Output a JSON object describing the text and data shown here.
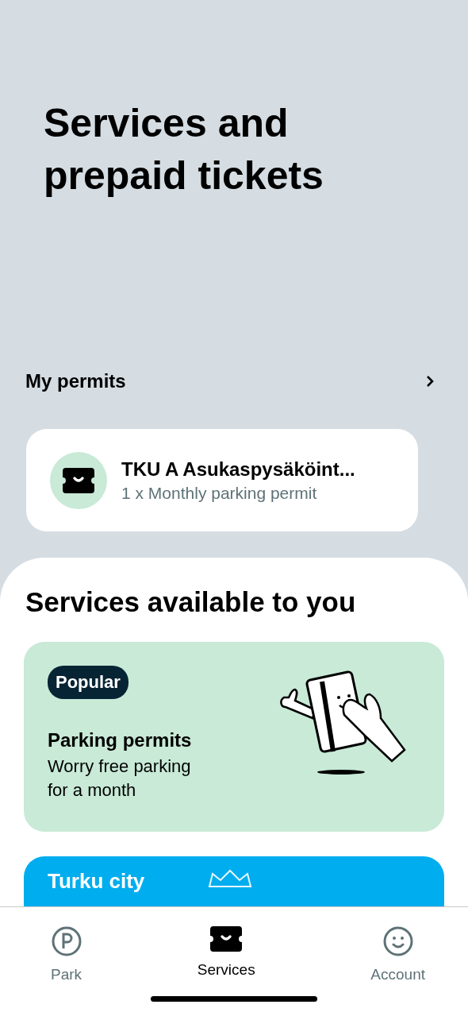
{
  "header": {
    "title": "Services and prepaid tickets"
  },
  "permits": {
    "heading": "My permits",
    "items": [
      {
        "name": "TKU A Asukaspysäköint...",
        "detail": "1 x Monthly parking permit"
      }
    ]
  },
  "services": {
    "heading": "Services available to you",
    "cards": [
      {
        "kind": "promo",
        "badge": "Popular",
        "title": "Parking permits",
        "text": "Worry free parking for a month"
      },
      {
        "kind": "city",
        "title": "Turku city"
      }
    ]
  },
  "nav": [
    {
      "label": "Park",
      "kind": "park",
      "selected": false
    },
    {
      "label": "Services",
      "kind": "ticket",
      "selected": true
    },
    {
      "label": "Account",
      "kind": "account",
      "selected": false
    }
  ]
}
